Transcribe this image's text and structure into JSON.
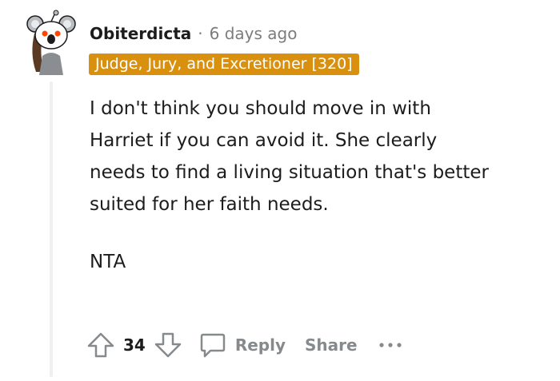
{
  "comment": {
    "username": "Obiterdicta",
    "separator": "·",
    "timestamp": "6 days ago",
    "flair": "Judge, Jury, and Excretioner [320]",
    "body": [
      "I don't think you should move in with Harriet if you can avoid it. She clearly needs to find a living situation that's better suited for her faith needs.",
      "NTA"
    ],
    "score": "34",
    "reply_label": "Reply",
    "share_label": "Share",
    "more_label": "•••"
  },
  "colors": {
    "flair_background": "#d9900f",
    "flair_text": "#ffffff",
    "meta_text": "#7c7c7c",
    "action_text": "#878a8c",
    "thread_line": "#edeff1"
  },
  "icons": {
    "upvote": "upvote-arrow-icon",
    "downvote": "downvote-arrow-icon",
    "reply": "speech-bubble-icon",
    "more": "more-options-icon",
    "avatar": "snoo-koala-avatar"
  }
}
